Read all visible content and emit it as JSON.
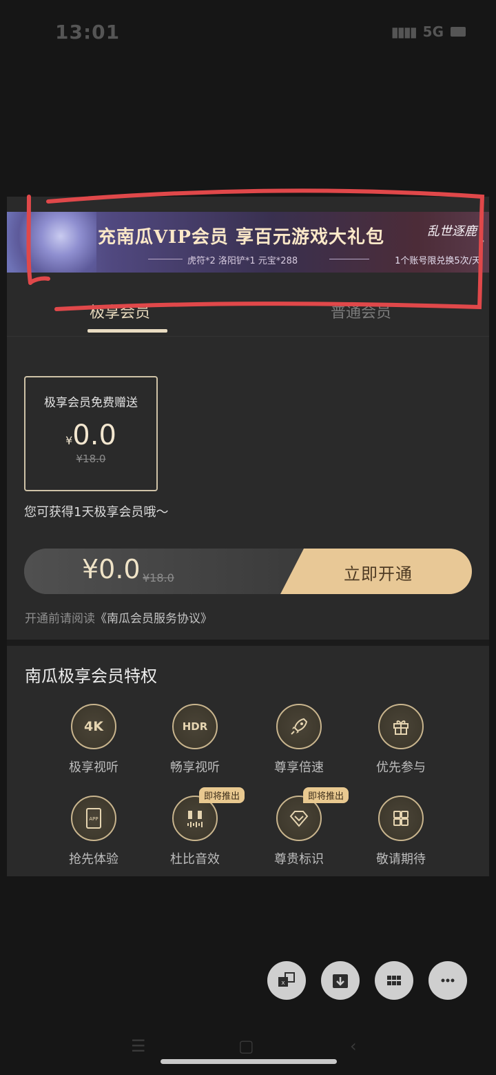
{
  "status_bar": {
    "time": "13:01",
    "network": "5G"
  },
  "banner": {
    "title": "充南瓜VIP会员 享百元游戏大礼包",
    "subtitle": "虎符*2 洛阳铲*1 元宝*288",
    "limit_text": "1个账号限兑换5次/天",
    "logo_text": "乱世逐鹿"
  },
  "tabs": [
    {
      "label": "极享会员",
      "active": true
    },
    {
      "label": "普通会员",
      "active": false
    }
  ],
  "plan": {
    "title": "极享会员免费赠送",
    "currency": "¥",
    "price": "0.0",
    "original_price": "¥18.0"
  },
  "gain_text": "您可获得1天极享会员哦～",
  "pay": {
    "price": "¥0.0",
    "original_price": "¥18.0",
    "button_label": "立即开通"
  },
  "agreement": {
    "prefix": "开通前请阅读",
    "link": "《南瓜会员服务协议》"
  },
  "privileges": {
    "title": "南瓜极享会员特权",
    "items": [
      {
        "icon_text": "4K",
        "label": "极享视听",
        "icon": "4k-icon"
      },
      {
        "icon_text": "HDR",
        "label": "畅享视听",
        "icon": "hdr-icon"
      },
      {
        "icon_text": "",
        "label": "尊享倍速",
        "icon": "rocket-icon"
      },
      {
        "icon_text": "",
        "label": "优先参与",
        "icon": "gift-icon"
      },
      {
        "icon_text": "APP",
        "label": "抢先体验",
        "icon": "tablet-app-icon"
      },
      {
        "icon_text": "",
        "label": "杜比音效",
        "icon": "dolby-icon",
        "badge": "即将推出"
      },
      {
        "icon_text": "",
        "label": "尊贵标识",
        "icon": "diamond-icon",
        "badge": "即将推出"
      },
      {
        "icon_text": "",
        "label": "敬请期待",
        "icon": "grid-icon"
      }
    ]
  },
  "fab_buttons": [
    "translate-icon",
    "download-icon",
    "apps-grid-icon",
    "more-icon"
  ],
  "colors": {
    "gold": "#e8c896",
    "dark": "#2a2a2a",
    "annotation_red": "#e0484a"
  }
}
